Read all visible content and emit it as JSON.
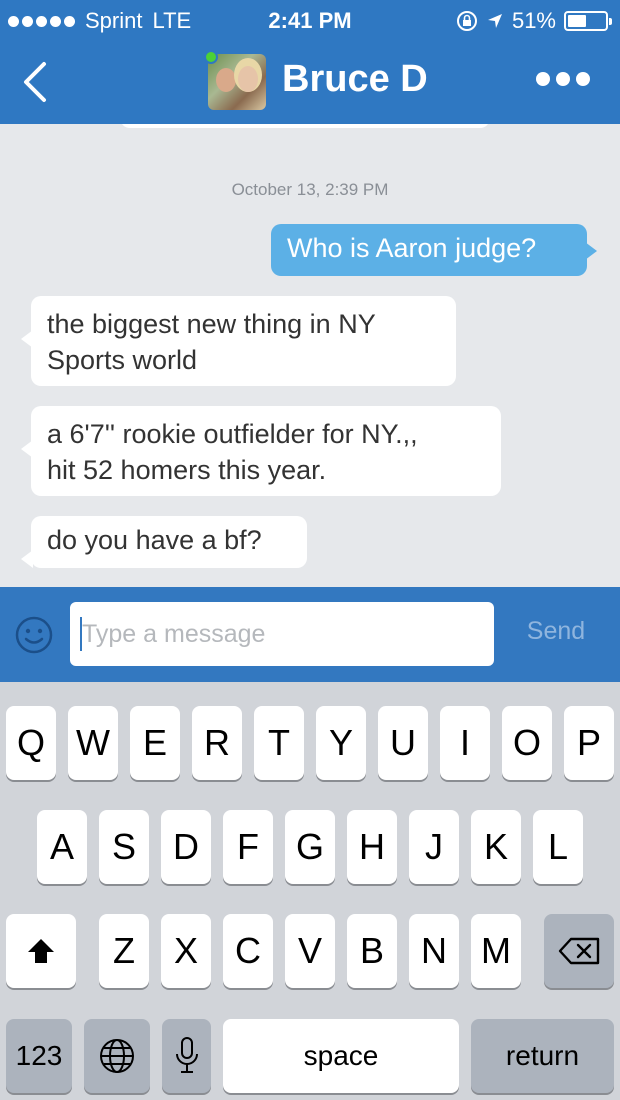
{
  "status_bar": {
    "carrier": "Sprint",
    "network": "LTE",
    "time": "2:41 PM",
    "battery": "51%",
    "battery_level": 0.51
  },
  "header": {
    "contact_name": "Bruce D",
    "online": true
  },
  "conversation": {
    "timestamp": "October 13, 2:39 PM",
    "messages": [
      {
        "direction": "outgoing",
        "text": "Who is Aaron judge?"
      },
      {
        "direction": "incoming",
        "text_line1": "the biggest new thing in NY",
        "text_line2": "Sports world"
      },
      {
        "direction": "incoming",
        "text_line1": "a 6'7'' rookie outfielder for NY.,,",
        "text_line2": "hit 52 homers this year."
      },
      {
        "direction": "incoming",
        "text": "do you have a bf?"
      }
    ]
  },
  "composer": {
    "placeholder": "Type a message",
    "send_label": "Send"
  },
  "keyboard": {
    "row1": [
      "Q",
      "W",
      "E",
      "R",
      "T",
      "Y",
      "U",
      "I",
      "O",
      "P"
    ],
    "row2": [
      "A",
      "S",
      "D",
      "F",
      "G",
      "H",
      "J",
      "K",
      "L"
    ],
    "row3": [
      "Z",
      "X",
      "C",
      "V",
      "B",
      "N",
      "M"
    ],
    "numbers_label": "123",
    "space_label": "space",
    "return_label": "return"
  },
  "colors": {
    "header_blue": "#2f78c2",
    "outgoing_bubble": "#5cb0e6",
    "incoming_bubble": "#ffffff",
    "online_dot": "#4cd137"
  }
}
